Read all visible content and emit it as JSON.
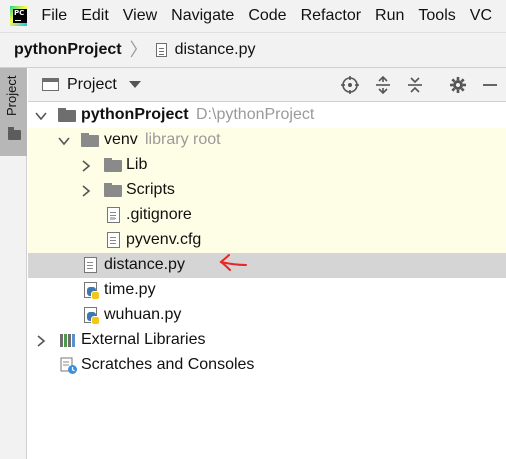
{
  "menubar": {
    "logo_text": "PC",
    "items": [
      "File",
      "Edit",
      "View",
      "Navigate",
      "Code",
      "Refactor",
      "Run",
      "Tools",
      "VC"
    ]
  },
  "breadcrumb": {
    "project": "pythonProject",
    "file": "distance.py"
  },
  "toolstrip": {
    "tab_label": "Project"
  },
  "panel": {
    "title": "Project",
    "icons": [
      "locate-icon",
      "expand-all-icon",
      "collapse-all-icon",
      "settings-icon",
      "hide-icon"
    ]
  },
  "tree": {
    "root": {
      "label": "pythonProject",
      "path": "D:\\pythonProject"
    },
    "venv": {
      "label": "venv",
      "hint": "library root"
    },
    "lib": "Lib",
    "scripts": "Scripts",
    "gitignore": ".gitignore",
    "pyvenv": "pyvenv.cfg",
    "distance": "distance.py",
    "time": "time.py",
    "wuhuan": "wuhuan.py",
    "external": "External Libraries",
    "scratches": "Scratches and Consoles"
  },
  "colors": {
    "venv_background": "#fefee6",
    "selection": "#d5d5d5",
    "annotation_arrow": "#e8262a"
  }
}
